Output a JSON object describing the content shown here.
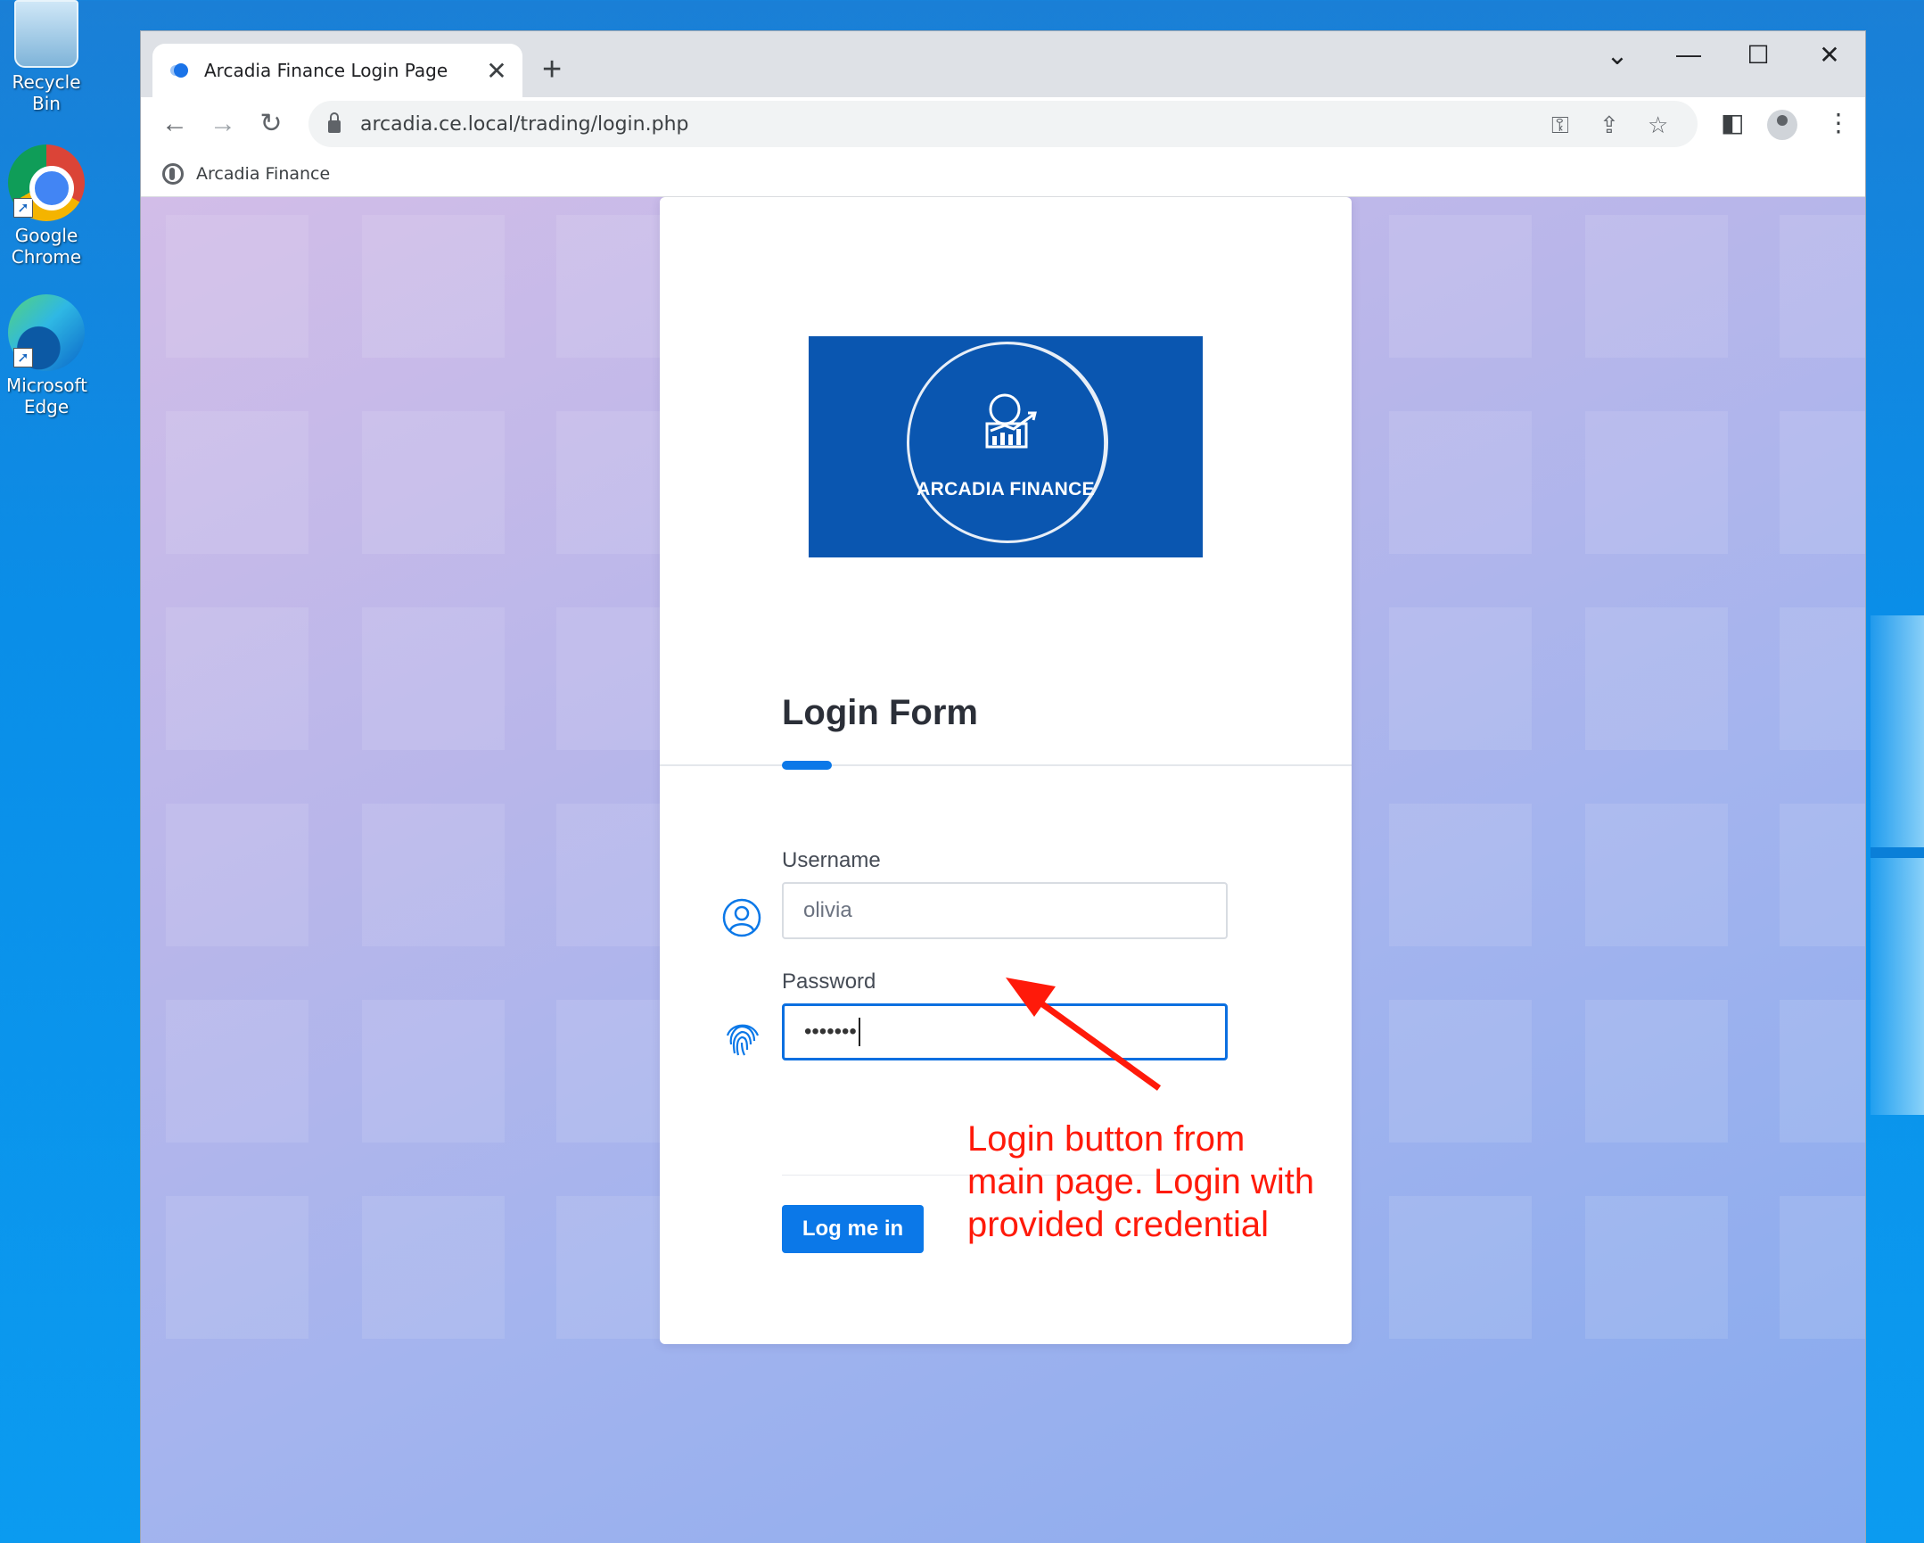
{
  "desktop": {
    "icons": [
      {
        "label": "Recycle Bin",
        "icon": "recycle-bin-icon"
      },
      {
        "label": "Google Chrome",
        "icon": "chrome-icon"
      },
      {
        "label": "Microsoft Edge",
        "icon": "edge-icon"
      }
    ]
  },
  "browser": {
    "tab": {
      "title": "Arcadia Finance Login Page",
      "close": "✕"
    },
    "new_tab": "+",
    "window_controls": {
      "dropdown": "⌄",
      "minimize": "—",
      "maximize": "☐",
      "close": "✕"
    },
    "nav": {
      "back": "←",
      "forward": "→",
      "reload": "↻"
    },
    "url": "arcadia.ce.local/trading/login.php",
    "omnibox_icons": {
      "key": "⚿",
      "share": "⇪",
      "star": "☆"
    },
    "toolbar_icons": {
      "side_panel": "◧",
      "menu": "⋮"
    },
    "bookmark": {
      "label": "Arcadia Finance"
    }
  },
  "page": {
    "logo_text": "ARCADIA FINANCE",
    "form_title": "Login Form",
    "username": {
      "label": "Username",
      "value": "olivia"
    },
    "password": {
      "label": "Password",
      "value": "•••••••"
    },
    "login_button": "Log me in"
  },
  "annotation": {
    "line1": "Login button from",
    "line2": "main page. Login with",
    "line3": "provided credential",
    "color": "#ff1a0a"
  },
  "colors": {
    "accent": "#0b78e8",
    "logo_bg": "#0a56b0"
  }
}
